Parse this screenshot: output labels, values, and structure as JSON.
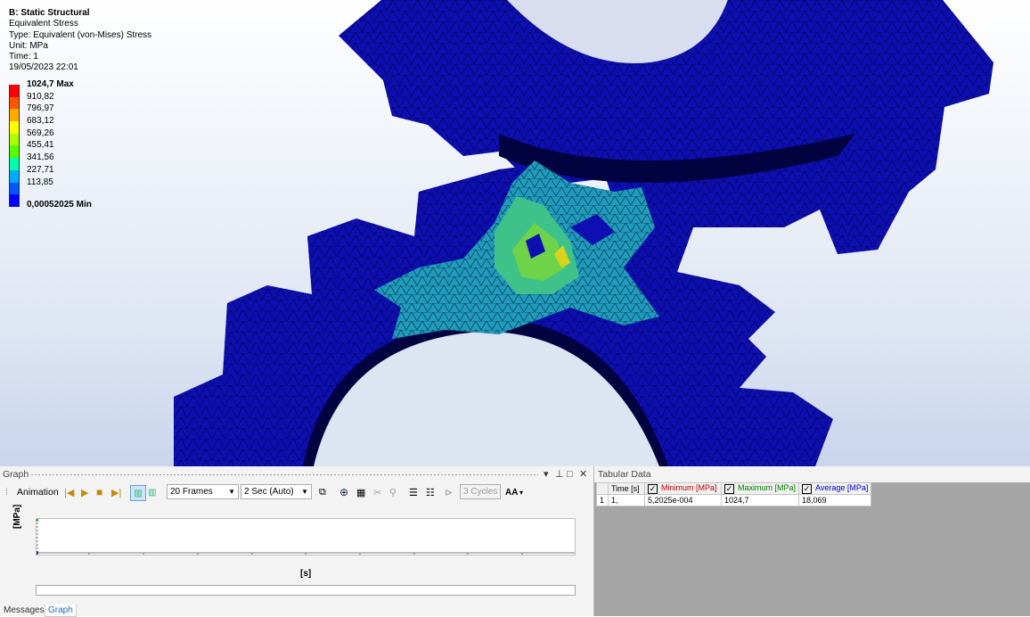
{
  "result": {
    "title": "B: Static Structural",
    "name": "Equivalent Stress",
    "type": "Type: Equivalent (von-Mises) Stress",
    "unit": "Unit: MPa",
    "time": "Time: 1",
    "date": "19/05/2023 22:01"
  },
  "legend": [
    {
      "label": "1024,7 Max",
      "color": "#ff0000"
    },
    {
      "label": "910,82",
      "color": "#ff5500"
    },
    {
      "label": "796,97",
      "color": "#ffaa00"
    },
    {
      "label": "683,12",
      "color": "#ffff00"
    },
    {
      "label": "569,26",
      "color": "#aaff00"
    },
    {
      "label": "455,41",
      "color": "#55ff00"
    },
    {
      "label": "341,56",
      "color": "#00ffaa"
    },
    {
      "label": "227,71",
      "color": "#00aaff"
    },
    {
      "label": "113,85",
      "color": "#0055ff"
    },
    {
      "label": "0,00052025 Min",
      "color": "#0000ff"
    }
  ],
  "graph": {
    "title": "Graph",
    "animation_label": "Animation",
    "frames": "20 Frames",
    "duration": "2 Sec (Auto)",
    "cycles": "3 Cycles",
    "aa": "AA",
    "ylabel": "[MPa]",
    "xlabel": "[s]"
  },
  "tabs": {
    "messages": "Messages",
    "graph": "Graph"
  },
  "tabular": {
    "title": "Tabular Data",
    "headers": {
      "time": "Time [s]",
      "min": "Minimum [MPa]",
      "max": "Maximum [MPa]",
      "avg": "Average [MPa]"
    },
    "row": {
      "index": "1",
      "time": "1,",
      "min": "5,2025e-004",
      "max": "1024,7",
      "avg": "18,069"
    }
  },
  "colors": {
    "min_header": "#c00000",
    "max_header": "#008000",
    "avg_header": "#0000c0",
    "mesh": "#00008a",
    "gear": "#0d0fb0"
  }
}
